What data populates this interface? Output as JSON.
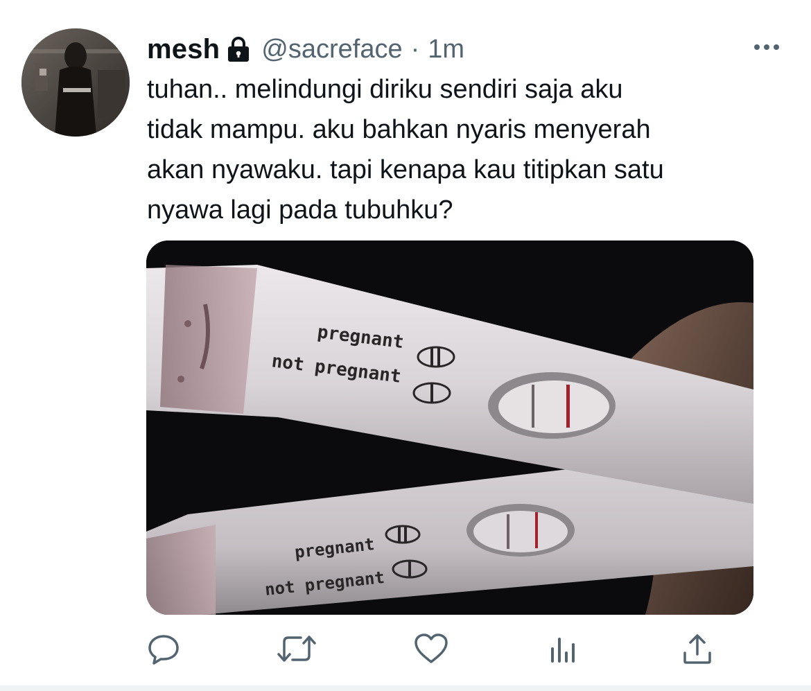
{
  "tweet": {
    "display_name": "mesh",
    "handle": "@sacreface",
    "separator": "·",
    "time": "1m",
    "text": "tuhan.. melindungi diriku sendiri saja aku\ntidak mampu. aku bahkan nyaris menyerah\nakan nyawaku. tapi kenapa kau titipkan satu\nnyawa lagi pada tubuhku?"
  },
  "media": {
    "test1_label_pregnant": "pregnant",
    "test1_label_not_pregnant": "not pregnant",
    "test2_label_pregnant": "pregnant",
    "test2_label_not_pregnant": "not pregnant"
  },
  "icons": {
    "account_status": "lock-icon",
    "menu": "more-icon",
    "actions": [
      "reply-icon",
      "retweet-icon",
      "like-icon",
      "analytics-icon",
      "share-icon"
    ]
  },
  "colors": {
    "text_primary": "#0f1419",
    "text_secondary": "#536471",
    "icon": "#536471",
    "test_line": "#a4202a"
  }
}
